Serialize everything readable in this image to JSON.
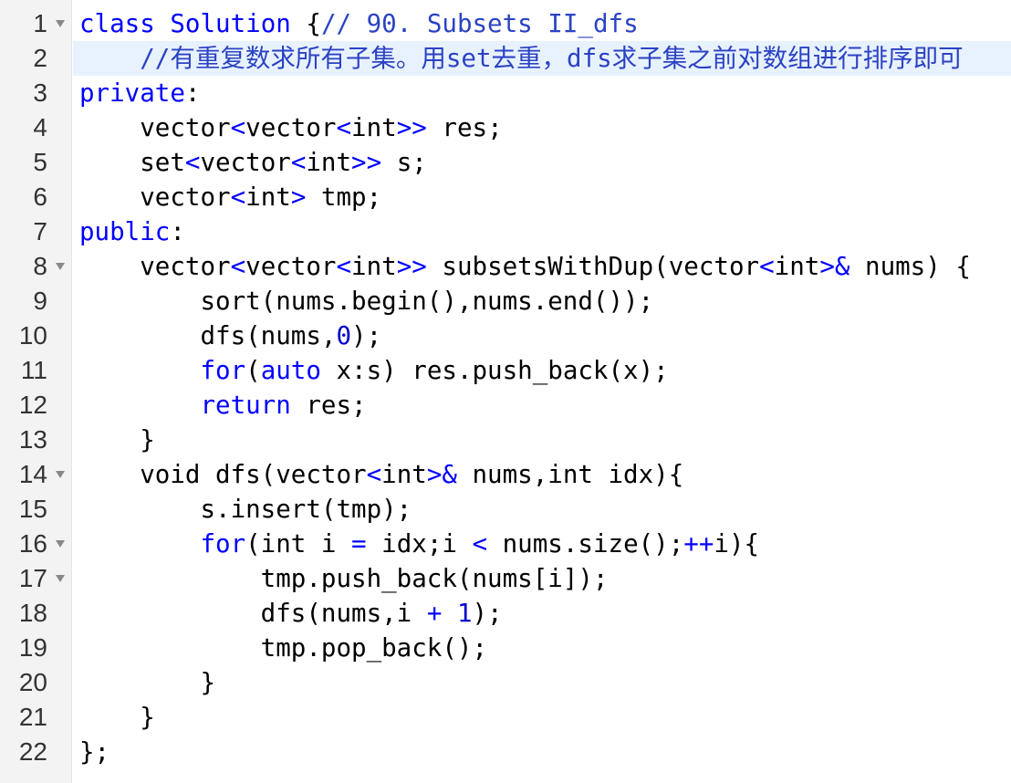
{
  "editor": {
    "active_line": 2,
    "colors": {
      "keyword": "#0000ff",
      "comment": "#2b43c4",
      "text": "#000000",
      "gutter_bg": "#f3f3f3",
      "active_line_bg": "#e8f2fe"
    },
    "lines": [
      {
        "number": "1",
        "fold": true,
        "tokens": [
          [
            "kw",
            "class"
          ],
          [
            "txt",
            " "
          ],
          [
            "kw",
            "Solution"
          ],
          [
            "txt",
            " {"
          ],
          [
            "cb",
            "// 90. Subsets II_dfs"
          ]
        ]
      },
      {
        "number": "2",
        "fold": false,
        "tokens": [
          [
            "txt",
            "    "
          ],
          [
            "cb",
            "//有重复数求所有子集。用set去重，dfs求子集之前对数组进行排序即可"
          ]
        ]
      },
      {
        "number": "3",
        "fold": false,
        "tokens": [
          [
            "kw",
            "private"
          ],
          [
            "txt",
            ":"
          ]
        ]
      },
      {
        "number": "4",
        "fold": false,
        "tokens": [
          [
            "txt",
            "    vector"
          ],
          [
            "kw",
            "<"
          ],
          [
            "txt",
            "vector"
          ],
          [
            "kw",
            "<"
          ],
          [
            "txt",
            "int"
          ],
          [
            "kw",
            ">>"
          ],
          [
            "txt",
            " res;"
          ]
        ]
      },
      {
        "number": "5",
        "fold": false,
        "tokens": [
          [
            "txt",
            "    set"
          ],
          [
            "kw",
            "<"
          ],
          [
            "txt",
            "vector"
          ],
          [
            "kw",
            "<"
          ],
          [
            "txt",
            "int"
          ],
          [
            "kw",
            ">>"
          ],
          [
            "txt",
            " s;"
          ]
        ]
      },
      {
        "number": "6",
        "fold": false,
        "tokens": [
          [
            "txt",
            "    vector"
          ],
          [
            "kw",
            "<"
          ],
          [
            "txt",
            "int"
          ],
          [
            "kw",
            ">"
          ],
          [
            "txt",
            " tmp;"
          ]
        ]
      },
      {
        "number": "7",
        "fold": false,
        "tokens": [
          [
            "kw",
            "public"
          ],
          [
            "txt",
            ":"
          ]
        ]
      },
      {
        "number": "8",
        "fold": true,
        "tokens": [
          [
            "txt",
            "    vector"
          ],
          [
            "kw",
            "<"
          ],
          [
            "txt",
            "vector"
          ],
          [
            "kw",
            "<"
          ],
          [
            "txt",
            "int"
          ],
          [
            "kw",
            ">>"
          ],
          [
            "txt",
            " subsetsWithDup(vector"
          ],
          [
            "kw",
            "<"
          ],
          [
            "txt",
            "int"
          ],
          [
            "kw",
            ">&"
          ],
          [
            "txt",
            " nums) {"
          ]
        ]
      },
      {
        "number": "9",
        "fold": false,
        "tokens": [
          [
            "txt",
            "        sort(nums.begin(),nums.end());"
          ]
        ]
      },
      {
        "number": "10",
        "fold": false,
        "tokens": [
          [
            "txt",
            "        dfs(nums,"
          ],
          [
            "num",
            "0"
          ],
          [
            "txt",
            ");"
          ]
        ]
      },
      {
        "number": "11",
        "fold": false,
        "tokens": [
          [
            "txt",
            "        "
          ],
          [
            "kw",
            "for"
          ],
          [
            "txt",
            "("
          ],
          [
            "kw",
            "auto"
          ],
          [
            "txt",
            " x:s) res.push_back(x);"
          ]
        ]
      },
      {
        "number": "12",
        "fold": false,
        "tokens": [
          [
            "txt",
            "        "
          ],
          [
            "kw",
            "return"
          ],
          [
            "txt",
            " res;"
          ]
        ]
      },
      {
        "number": "13",
        "fold": false,
        "tokens": [
          [
            "txt",
            "    }"
          ]
        ]
      },
      {
        "number": "14",
        "fold": true,
        "tokens": [
          [
            "txt",
            "    void dfs(vector"
          ],
          [
            "kw",
            "<"
          ],
          [
            "txt",
            "int"
          ],
          [
            "kw",
            ">&"
          ],
          [
            "txt",
            " nums,int idx){"
          ]
        ]
      },
      {
        "number": "15",
        "fold": false,
        "tokens": [
          [
            "txt",
            "        s.insert(tmp);"
          ]
        ]
      },
      {
        "number": "16",
        "fold": true,
        "tokens": [
          [
            "txt",
            "        "
          ],
          [
            "kw",
            "for"
          ],
          [
            "txt",
            "(int i "
          ],
          [
            "kw",
            "="
          ],
          [
            "txt",
            " idx;i "
          ],
          [
            "kw",
            "<"
          ],
          [
            "txt",
            " nums.size();"
          ],
          [
            "kw",
            "++"
          ],
          [
            "txt",
            "i){"
          ]
        ]
      },
      {
        "number": "17",
        "fold": true,
        "tokens": [
          [
            "txt",
            "            tmp.push_back(nums[i]);"
          ]
        ]
      },
      {
        "number": "18",
        "fold": false,
        "tokens": [
          [
            "txt",
            "            dfs(nums,i "
          ],
          [
            "kw",
            "+"
          ],
          [
            "txt",
            " "
          ],
          [
            "num",
            "1"
          ],
          [
            "txt",
            ");"
          ]
        ]
      },
      {
        "number": "19",
        "fold": false,
        "tokens": [
          [
            "txt",
            "            tmp.pop_back();"
          ]
        ]
      },
      {
        "number": "20",
        "fold": false,
        "tokens": [
          [
            "txt",
            "        }"
          ]
        ]
      },
      {
        "number": "21",
        "fold": false,
        "tokens": [
          [
            "txt",
            "    }"
          ]
        ]
      },
      {
        "number": "22",
        "fold": false,
        "tokens": [
          [
            "txt",
            "};"
          ]
        ]
      }
    ]
  }
}
